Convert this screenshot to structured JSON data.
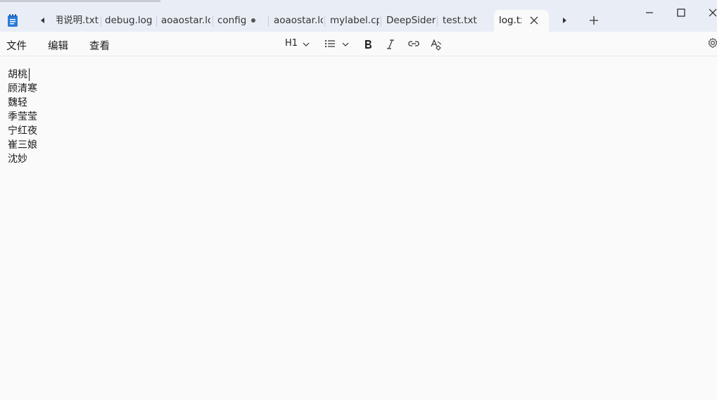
{
  "tabs": [
    {
      "label": "使用说明.txt"
    },
    {
      "label": "debug.log"
    },
    {
      "label": "aoaostar.log"
    },
    {
      "label": "config"
    },
    {
      "label": "aoaostar.log"
    },
    {
      "label": "mylabel.cpp"
    },
    {
      "label": "DeepSider安装.txt"
    },
    {
      "label": "test.txt"
    },
    {
      "label": "log.txt"
    }
  ],
  "menu": {
    "file": "文件",
    "edit": "编辑",
    "view": "查看"
  },
  "toolbar": {
    "heading": "H1"
  },
  "editor": {
    "lines": [
      "胡桃",
      "顾清寒",
      "魏轻",
      "季莹莹",
      "宁红夜",
      "崔三娘",
      "沈妙"
    ]
  },
  "colors": {
    "titlebar_bg": "#e9eef6",
    "editor_bg": "#fafafa",
    "active_tab_bg": "#fafafa"
  }
}
